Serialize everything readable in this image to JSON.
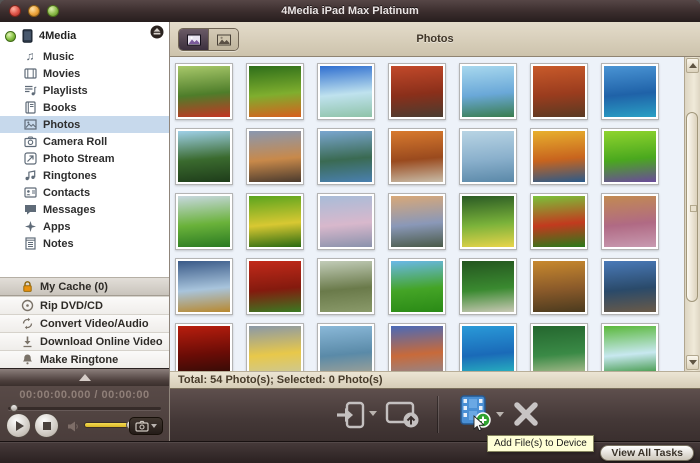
{
  "window": {
    "title": "4Media iPad Max Platinum"
  },
  "sidebar": {
    "device": {
      "label": "4Media"
    },
    "items": [
      {
        "icon": "music-icon",
        "label": "Music"
      },
      {
        "icon": "movies-icon",
        "label": "Movies"
      },
      {
        "icon": "playlists-icon",
        "label": "Playlists"
      },
      {
        "icon": "books-icon",
        "label": "Books"
      },
      {
        "icon": "photos-icon",
        "label": "Photos",
        "selected": true
      },
      {
        "icon": "camera-roll-icon",
        "label": "Camera Roll"
      },
      {
        "icon": "photo-stream-icon",
        "label": "Photo Stream"
      },
      {
        "icon": "ringtones-icon",
        "label": "Ringtones"
      },
      {
        "icon": "contacts-icon",
        "label": "Contacts"
      },
      {
        "icon": "messages-icon",
        "label": "Messages"
      },
      {
        "icon": "apps-icon",
        "label": "Apps"
      },
      {
        "icon": "notes-icon",
        "label": "Notes"
      }
    ],
    "cache": {
      "icon": "lock-icon",
      "label": "My Cache (0)"
    },
    "tools": [
      {
        "icon": "disc-icon",
        "label": "Rip DVD/CD"
      },
      {
        "icon": "convert-icon",
        "label": "Convert Video/Audio"
      },
      {
        "icon": "download-icon",
        "label": "Download Online Video"
      },
      {
        "icon": "bell-icon",
        "label": "Make Ringtone"
      }
    ]
  },
  "player": {
    "time": "00:00:00.000 / 00:00:00"
  },
  "content": {
    "header": {
      "title": "Photos"
    },
    "status": "Total: 54 Photo(s); Selected: 0 Photo(s)",
    "photos": [
      {
        "name": "spring-park-red-flowers",
        "colors": [
          "#a8c86a",
          "#4e7d2a",
          "#c43524"
        ]
      },
      {
        "name": "forest-lake-orange-bush",
        "colors": [
          "#2e6e1a",
          "#7fae2e",
          "#d85f1e"
        ]
      },
      {
        "name": "tropical-beach",
        "colors": [
          "#2f6fd0",
          "#bfe2ee",
          "#8fc3a8"
        ]
      },
      {
        "name": "red-autumn-trees",
        "colors": [
          "#c2492a",
          "#8a2f1a",
          "#4a3c30"
        ]
      },
      {
        "name": "waterfall",
        "colors": [
          "#a8d8ee",
          "#6aa8d8",
          "#3a7d4e"
        ]
      },
      {
        "name": "autumn-steps",
        "colors": [
          "#c85a2a",
          "#9a3c1e",
          "#5a3a22"
        ]
      },
      {
        "name": "palm-beach",
        "colors": [
          "#4a94d4",
          "#1f62a8",
          "#2aa0c4"
        ]
      },
      {
        "name": "sunlit-valley",
        "colors": [
          "#9fd0e8",
          "#3a6a2e",
          "#1e3c1a"
        ]
      },
      {
        "name": "sunset-shore-tree",
        "colors": [
          "#8a98b0",
          "#c8894a",
          "#4a3a2e"
        ]
      },
      {
        "name": "mountain-lake-pines",
        "colors": [
          "#7aa6d0",
          "#3a6a52",
          "#4a80b0"
        ]
      },
      {
        "name": "autumn-lane",
        "colors": [
          "#d87a2e",
          "#9a4a1e",
          "#c8bca8"
        ]
      },
      {
        "name": "crashing-wave",
        "colors": [
          "#b8d4e4",
          "#8ab0cc",
          "#5a88a8"
        ]
      },
      {
        "name": "autumn-riverside",
        "colors": [
          "#e8b02e",
          "#c8641e",
          "#2a5a8a"
        ]
      },
      {
        "name": "spring-forest-purple",
        "colors": [
          "#8fd42e",
          "#4aa81e",
          "#6a4a9a"
        ]
      },
      {
        "name": "hillside-cottage",
        "colors": [
          "#c8d8e0",
          "#6ab23a",
          "#2a7a22"
        ]
      },
      {
        "name": "parrot-in-bush",
        "colors": [
          "#5aa41e",
          "#d8c832",
          "#2a6a12"
        ]
      },
      {
        "name": "blossom-mountain",
        "colors": [
          "#a8bcd8",
          "#d8b8cc",
          "#8a92ac"
        ]
      },
      {
        "name": "dusk-river-hut",
        "colors": [
          "#d8a878",
          "#8a98b8",
          "#4a5a48"
        ]
      },
      {
        "name": "yellow-butterfly",
        "colors": [
          "#2a5a24",
          "#7ab23a",
          "#e8d44a"
        ]
      },
      {
        "name": "monarch-butterfly",
        "colors": [
          "#7ac23a",
          "#c23a1e",
          "#2a7a1a"
        ]
      },
      {
        "name": "pink-flower-meadow",
        "colors": [
          "#c28a52",
          "#b06a84",
          "#c89ab0"
        ]
      },
      {
        "name": "storm-over-field",
        "colors": [
          "#3a5a88",
          "#a8c4dc",
          "#b8882e"
        ]
      },
      {
        "name": "red-tree-park",
        "colors": [
          "#c22a1a",
          "#841a0e",
          "#3a7a22"
        ]
      },
      {
        "name": "lone-tree-plain",
        "colors": [
          "#c2ccb8",
          "#6a7a4a",
          "#8a9a6a"
        ]
      },
      {
        "name": "meadow-stream",
        "colors": [
          "#6ab8e8",
          "#44a426",
          "#2a8a16"
        ]
      },
      {
        "name": "forest-path",
        "colors": [
          "#24551f",
          "#3a8a30",
          "#c8c8b4"
        ]
      },
      {
        "name": "autumn-stone-bridge",
        "colors": [
          "#c8892e",
          "#8a5a2a",
          "#4a3a1e"
        ]
      },
      {
        "name": "mountain-lake-rocks",
        "colors": [
          "#4a7ab8",
          "#2a4a6a",
          "#6a5a48"
        ]
      },
      {
        "name": "crimson-forest",
        "colors": [
          "#b81e0e",
          "#6a0c06",
          "#2a0c06"
        ]
      },
      {
        "name": "sunset-flower-field",
        "colors": [
          "#8a98a8",
          "#e8c84a",
          "#c8c8a0"
        ]
      },
      {
        "name": "rocky-stream",
        "colors": [
          "#8ab8d8",
          "#5a8aa8",
          "#a8a494"
        ]
      },
      {
        "name": "red-rock-canyon",
        "colors": [
          "#4a6ab8",
          "#c86a3a",
          "#8a8a98"
        ]
      },
      {
        "name": "blue-lagoon",
        "colors": [
          "#2a9ad8",
          "#1a6ab8",
          "#2ac0c0"
        ]
      },
      {
        "name": "forest-clearing",
        "colors": [
          "#24662e",
          "#3a8a46",
          "#bcc49a"
        ]
      },
      {
        "name": "green-lakeside-hills",
        "colors": [
          "#5ab83a",
          "#c8e8f0",
          "#2a8a2a"
        ]
      }
    ]
  },
  "toolbar": {
    "tooltip": "Add File(s) to Device"
  },
  "footer": {
    "view_all_tasks": "View All Tasks"
  },
  "colors": {
    "selection": "#c7d9ec",
    "titlebar": "#3a2d2d",
    "toolbar": "#443837",
    "grid_bg": "#edf2f9",
    "status_bar": "#e3dcca",
    "tooltip_bg": "#ffffd6",
    "film_blue": "#4a8fd4",
    "plus_green": "#2fa32f",
    "volume_yellow": "#e9c83d",
    "lock_orange": "#e89210"
  }
}
